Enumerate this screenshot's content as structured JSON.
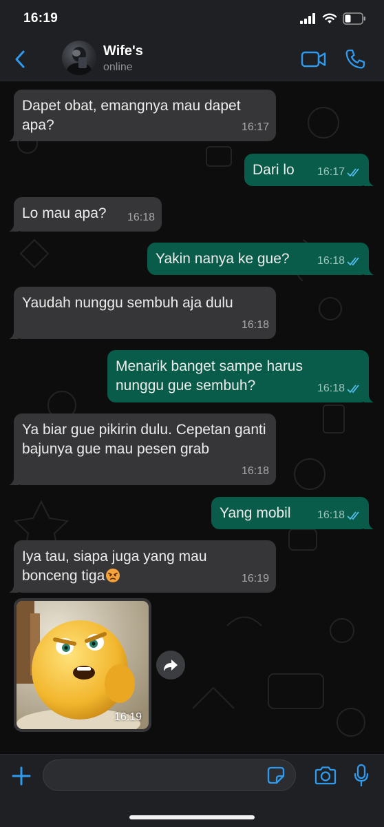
{
  "status_bar": {
    "time": "16:19"
  },
  "header": {
    "contact_name": "Wife's",
    "contact_status": "online"
  },
  "messages": [
    {
      "direction": "in",
      "text": "Dapet obat, emangnya mau dapet apa?",
      "time": "16:17"
    },
    {
      "direction": "out",
      "text": "Dari lo",
      "time": "16:17",
      "read": true
    },
    {
      "direction": "in",
      "text": "Lo mau apa?",
      "time": "16:18"
    },
    {
      "direction": "out",
      "text": "Yakin nanya ke gue?",
      "time": "16:18",
      "read": true
    },
    {
      "direction": "in",
      "text": "Yaudah nunggu sembuh aja dulu",
      "time": "16:18"
    },
    {
      "direction": "out",
      "text": "Menarik banget sampe harus nunggu gue sembuh?",
      "time": "16:18",
      "read": true
    },
    {
      "direction": "in",
      "text": "Ya biar gue pikirin dulu. Cepetan ganti bajunya gue mau pesen grab",
      "time": "16:18"
    },
    {
      "direction": "out",
      "text": "Yang mobil",
      "time": "16:18",
      "read": true
    },
    {
      "direction": "in",
      "text": "Iya tau, siapa juga yang mau bonceng tiga",
      "emoji": "angry-face",
      "time": "16:19"
    }
  ],
  "sticker": {
    "direction": "in",
    "time": "16:19",
    "subject": "angry-yellow-character"
  },
  "composer": {
    "placeholder": ""
  },
  "icons": {
    "back": "chevron-left-icon",
    "video_call": "video-camera-icon",
    "voice_call": "phone-icon",
    "forward": "forward-arrow-icon",
    "attach": "plus-icon",
    "sticker": "sticker-icon",
    "camera": "camera-icon",
    "mic": "microphone-icon",
    "read_receipt": "double-check-icon"
  },
  "colors": {
    "accent": "#2e9bf0",
    "incoming_bubble": "#363638",
    "outgoing_bubble": "#0a5c4a",
    "read_tick": "#53bdeb"
  }
}
